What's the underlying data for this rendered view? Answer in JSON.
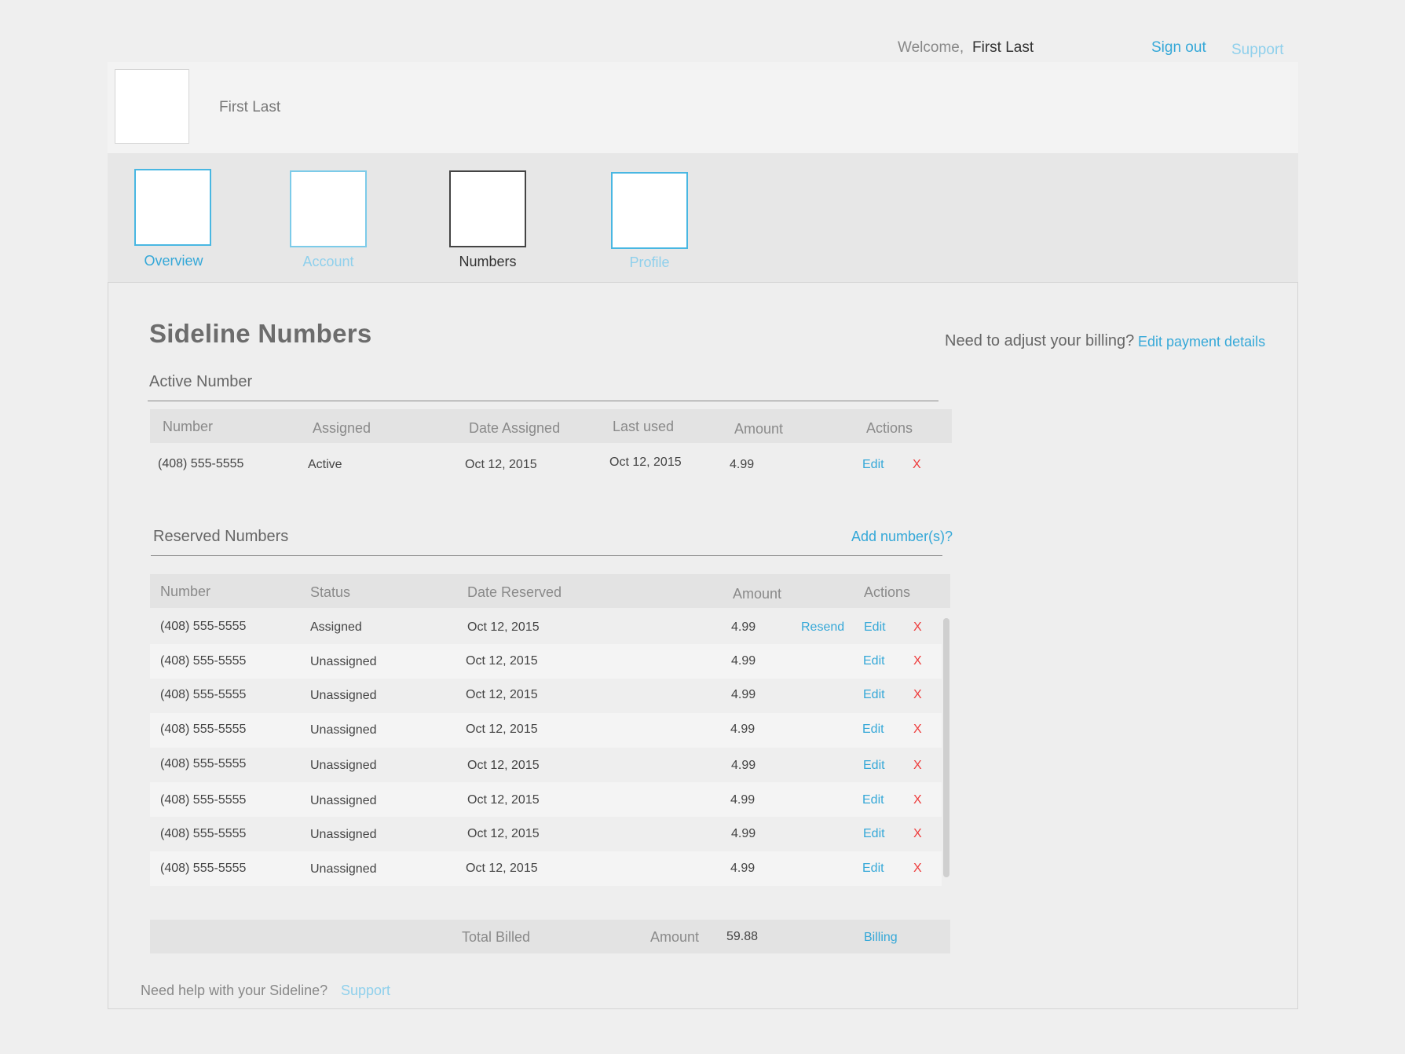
{
  "topbar": {
    "welcome_label": "Welcome,",
    "user_name": "First Last",
    "sign_out": "Sign out",
    "support": "Support"
  },
  "header": {
    "user_name": "First Last"
  },
  "nav": {
    "items": [
      {
        "label": "Overview",
        "state": "active"
      },
      {
        "label": "Account",
        "state": "inactive"
      },
      {
        "label": "Numbers",
        "state": "current"
      },
      {
        "label": "Profile",
        "state": "inactive"
      }
    ]
  },
  "page": {
    "title": "Sideline Numbers",
    "billing_question": "Need to adjust your billing?",
    "edit_payment": "Edit payment details"
  },
  "active_section": {
    "title": "Active Number",
    "headers": [
      "Number",
      "Assigned",
      "Date Assigned",
      "Last used",
      "Amount",
      "Actions"
    ],
    "row": {
      "number": "(408) 555-5555",
      "assigned": "Active",
      "date_assigned": "Oct 12, 2015",
      "last_used": "Oct 12, 2015",
      "amount": "4.99",
      "edit": "Edit",
      "delete": "X"
    }
  },
  "reserved_section": {
    "title": "Reserved Numbers",
    "add_link": "Add number(s)?",
    "headers": [
      "Number",
      "Status",
      "Date Reserved",
      "Amount",
      "Actions"
    ],
    "rows": [
      {
        "number": "(408) 555-5555",
        "status": "Assigned",
        "date": "Oct 12, 2015",
        "amount": "4.99",
        "resend": "Resend",
        "edit": "Edit",
        "delete": "X"
      },
      {
        "number": "(408) 555-5555",
        "status": "Unassigned",
        "date": "Oct 12, 2015",
        "amount": "4.99",
        "edit": "Edit",
        "delete": "X"
      },
      {
        "number": "(408) 555-5555",
        "status": "Unassigned",
        "date": "Oct 12, 2015",
        "amount": "4.99",
        "edit": "Edit",
        "delete": "X"
      },
      {
        "number": "(408) 555-5555",
        "status": "Unassigned",
        "date": "Oct 12, 2015",
        "amount": "4.99",
        "edit": "Edit",
        "delete": "X"
      },
      {
        "number": "(408) 555-5555",
        "status": "Unassigned",
        "date": "Oct 12, 2015",
        "amount": "4.99",
        "edit": "Edit",
        "delete": "X"
      },
      {
        "number": "(408) 555-5555",
        "status": "Unassigned",
        "date": "Oct 12, 2015",
        "amount": "4.99",
        "edit": "Edit",
        "delete": "X"
      },
      {
        "number": "(408) 555-5555",
        "status": "Unassigned",
        "date": "Oct 12, 2015",
        "amount": "4.99",
        "edit": "Edit",
        "delete": "X"
      },
      {
        "number": "(408) 555-5555",
        "status": "Unassigned",
        "date": "Oct 12, 2015",
        "amount": "4.99",
        "edit": "Edit",
        "delete": "X"
      }
    ]
  },
  "totals": {
    "label": "Total Billed",
    "amount_label": "Amount",
    "amount": "59.88",
    "billing_link": "Billing"
  },
  "footer": {
    "help_question": "Need help with your Sideline?",
    "support": "Support"
  },
  "colors": {
    "accent": "#35a8d8",
    "accent_light": "#8fd0ec",
    "danger": "#ee3b3b",
    "background": "#efefef"
  }
}
